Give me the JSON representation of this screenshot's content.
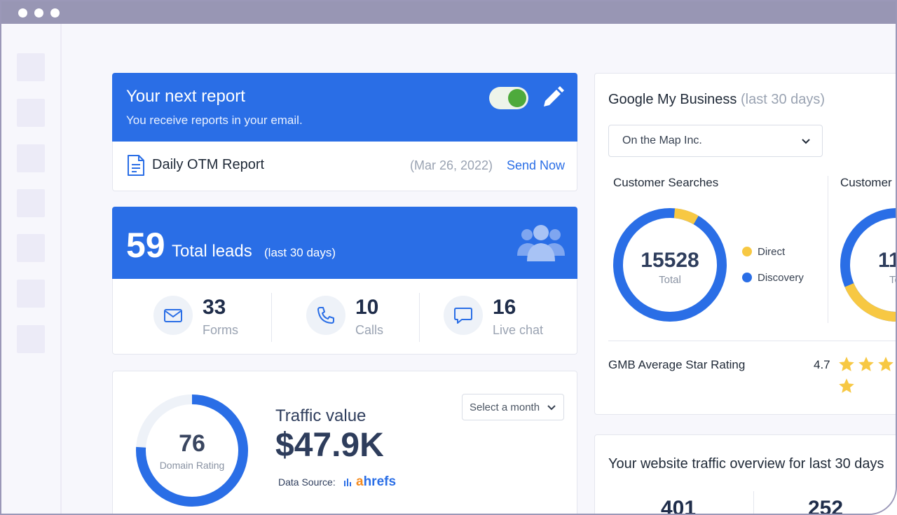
{
  "report": {
    "title": "Your next report",
    "subtitle": "You receive reports in your email.",
    "toggle_on": true,
    "name": "Daily OTM Report",
    "date": "(Mar 26, 2022)",
    "send_label": "Send Now"
  },
  "leads": {
    "count": "59",
    "label": "Total leads",
    "period": "(last 30 days)",
    "stats": [
      {
        "value": "33",
        "label": "Forms",
        "icon": "mail-icon"
      },
      {
        "value": "10",
        "label": "Calls",
        "icon": "phone-icon"
      },
      {
        "value": "16",
        "label": "Live chat",
        "icon": "chat-icon"
      }
    ]
  },
  "traffic": {
    "domain_rating": "76",
    "domain_rating_label": "Domain Rating",
    "domain_rating_fraction": 0.76,
    "title": "Traffic value",
    "value": "$47.9K",
    "data_source_label": "Data Source:",
    "data_source_name": "ahrefs",
    "month_select_label": "Select a month"
  },
  "gmb": {
    "title": "Google My Business",
    "period": "(last 30 days)",
    "business_select": "On the Map Inc.",
    "searches": {
      "title": "Customer Searches",
      "total": "15528",
      "total_label": "Total",
      "direct_fraction": 0.07,
      "legend": [
        {
          "label": "Direct",
          "color": "#f7c843"
        },
        {
          "label": "Discovery",
          "color": "#2a6ee6"
        }
      ]
    },
    "second": {
      "title": "Customer",
      "total": "11",
      "total_label": "To",
      "yellow_fraction": 0.2
    },
    "rating_label": "GMB Average Star Rating",
    "rating_value": "4.7",
    "rating_stars": 4.7
  },
  "website_traffic": {
    "title": "Your website traffic overview for last 30 days",
    "values": [
      "401",
      "252"
    ]
  },
  "colors": {
    "primary": "#2a6ee6",
    "yellow": "#f7c843",
    "green": "#4eaa3c"
  }
}
